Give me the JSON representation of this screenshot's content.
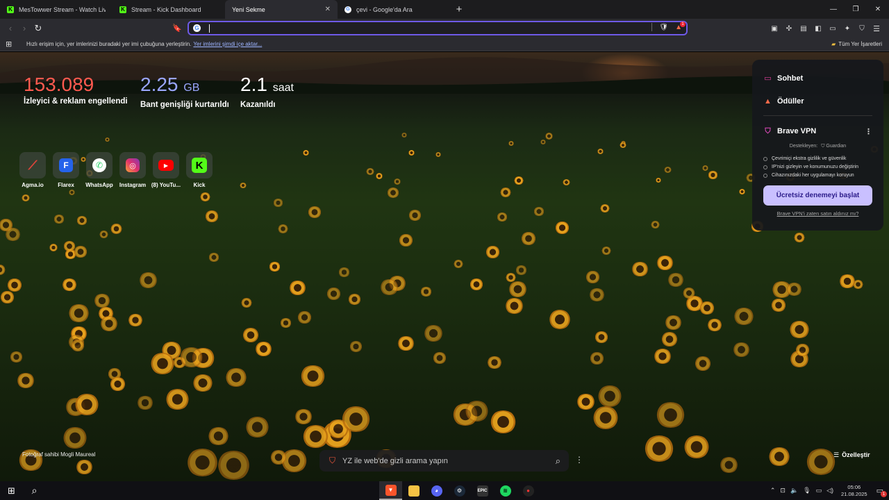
{
  "tabs": [
    {
      "title": "MesTowwer Stream - Watch Live",
      "favicon": "kick-icon",
      "active": false
    },
    {
      "title": "Stream - Kick Dashboard",
      "favicon": "kick-icon",
      "active": false
    },
    {
      "title": "Yeni Sekme",
      "favicon": "",
      "active": true
    },
    {
      "title": "çevi - Google'da Ara",
      "favicon": "google-icon",
      "active": false
    }
  ],
  "window_controls": [
    "minimize",
    "restore",
    "close"
  ],
  "toolbar": {
    "omnibox_value": "",
    "omnibox_engine_icon": "google-icon",
    "shields_badge": "1"
  },
  "bookmarks_bar": {
    "prompt": "Hızlı erişim için, yer imlerinizi buradaki yer imi çubuğuna yerleştirin.",
    "import_link": "Yer imlerini şimdi içe aktar...",
    "all_bookmarks": "Tüm Yer İşaretleri"
  },
  "stats": [
    {
      "value": "153.089",
      "unit": "",
      "label": "İzleyici & reklam engellendi",
      "color": "#ff5a4f"
    },
    {
      "value": "2.25",
      "unit": "GB",
      "label": "Bant genişliği kurtarıldı",
      "color": "#9aa6ff"
    },
    {
      "value": "2.1",
      "unit": "saat",
      "label": "Kazanıldı",
      "color": "#ffffff"
    }
  ],
  "top_sites": [
    {
      "label": "Agma.io",
      "icon": "agma-icon"
    },
    {
      "label": "Flarex",
      "icon": "flarex-icon"
    },
    {
      "label": "WhatsApp",
      "icon": "whatsapp-icon"
    },
    {
      "label": "Instagram",
      "icon": "instagram-icon"
    },
    {
      "label": "(8) YouTu...",
      "icon": "youtube-icon"
    },
    {
      "label": "Kick",
      "icon": "kick-icon"
    }
  ],
  "panel": {
    "chat": "Sohbet",
    "rewards": "Ödüller",
    "vpn_title": "Brave VPN",
    "powered_by": "Destekleyen:",
    "powered_brand": "Guardian",
    "features": [
      "Çevrimiçi ekstra gizlilik ve güvenlik",
      "IP'nizi gizleyin ve konumunuzu değiştirin",
      "Cihazınızdaki her uygulamayı koruyun"
    ],
    "cta": "Ücretsiz denemeyi başlat",
    "already": "Brave VPN'i zaten satın aldınız mı?"
  },
  "credit": "Fotoğraf sahibi Mogli Maureal",
  "search": {
    "placeholder": "YZ ile web'de gizli arama yapın"
  },
  "customize": "Özelleştir",
  "taskbar": {
    "apps": [
      "brave-icon",
      "file-explorer-icon",
      "discord-icon",
      "steam-icon",
      "epic-games-icon",
      "spotify-icon",
      "recorder-icon"
    ],
    "time": "05:06",
    "date": "21.08.2025",
    "notification_count": "1"
  }
}
